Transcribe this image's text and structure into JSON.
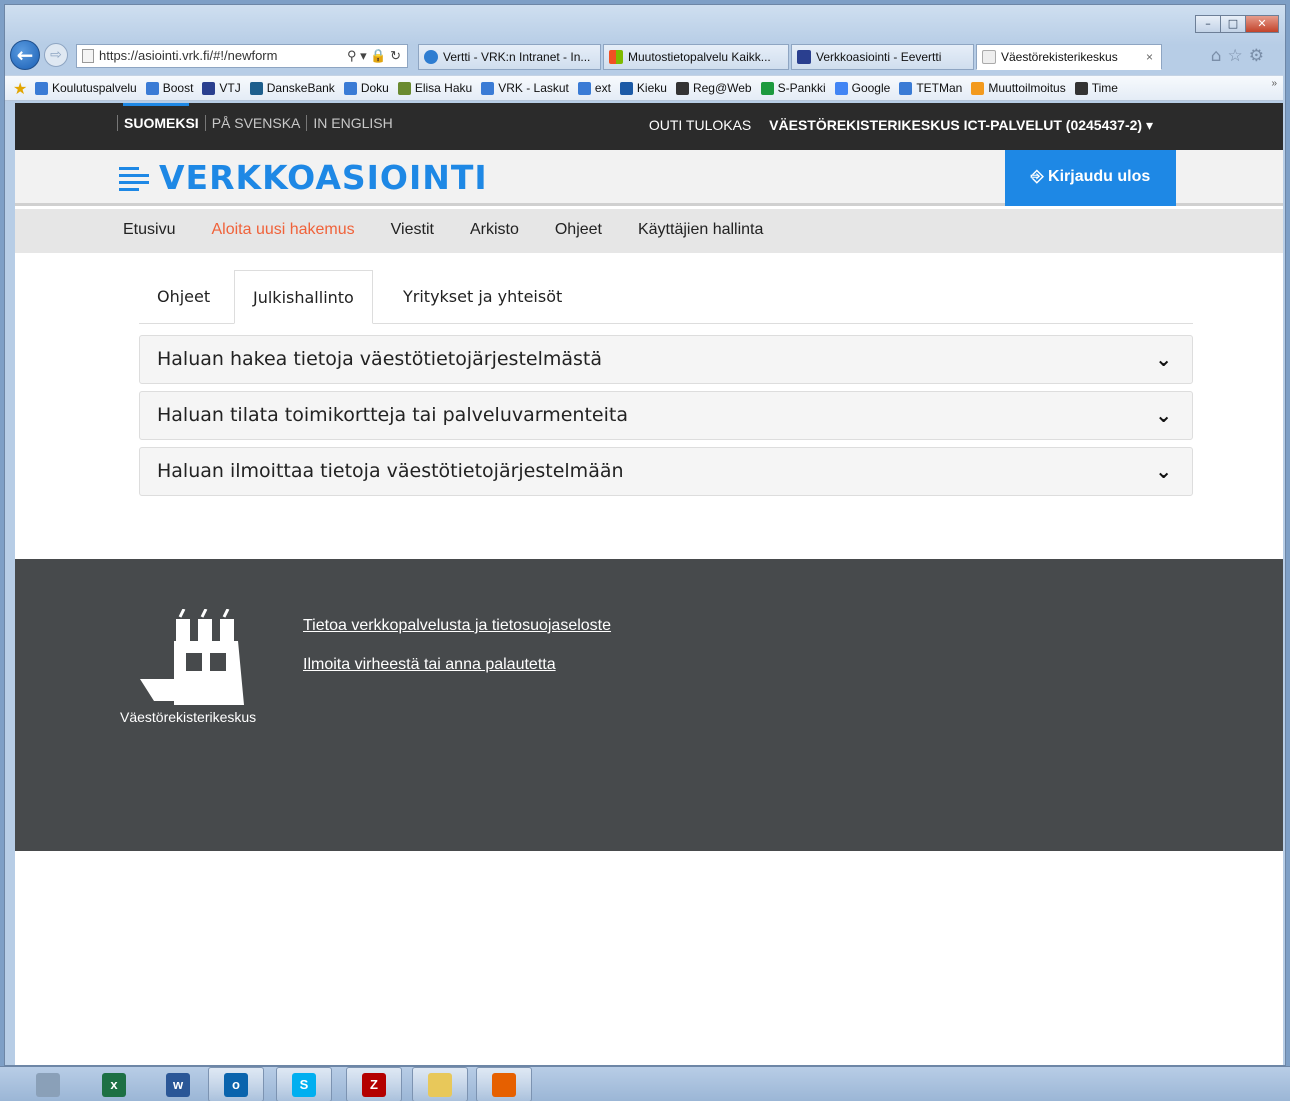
{
  "browser": {
    "address": "https://asiointi.vrk.fi/#!/newform",
    "address_actions": "⚲ ▾ 🔒 ↻",
    "tabs": [
      {
        "label": "Vertti - VRK:n Intranet - In...",
        "color": "#2e7dd1"
      },
      {
        "label": "Muutostietopalvelu Kaikk...",
        "color": "#e8a000"
      },
      {
        "label": "Verkkoasiointi - Eevertti",
        "color": "#2a3f8f"
      },
      {
        "label": "Väestörekisterikeskus",
        "color": "#d0d0d0"
      }
    ],
    "tab_close": "×",
    "back_icon": "←",
    "forward_icon": "⇨",
    "toolbar_icons": "⌂☆⚙",
    "window_controls": {
      "minimize": "–",
      "maximize": "□",
      "close": "✕"
    }
  },
  "favorites": {
    "more": "»",
    "items": [
      {
        "label": "Koulutuspalvelu",
        "icon": "ie-page-icon",
        "color": "#3a7bd5"
      },
      {
        "label": "Boost",
        "icon": "ie-page-icon",
        "color": "#3a7bd5"
      },
      {
        "label": "VTJ",
        "icon": "vtj-icon",
        "color": "#2a3f8f"
      },
      {
        "label": "DanskeBank",
        "icon": "danske-icon",
        "color": "#1d5e8c"
      },
      {
        "label": "Doku",
        "icon": "ie-page-icon",
        "color": "#3a7bd5"
      },
      {
        "label": "Elisa Haku",
        "icon": "elisa-icon",
        "color": "#6a8a30"
      },
      {
        "label": "VRK - Laskut",
        "icon": "ie-page-icon",
        "color": "#3a7bd5"
      },
      {
        "label": "ext",
        "icon": "ie-page-icon",
        "color": "#3a7bd5"
      },
      {
        "label": "Kieku",
        "icon": "sap-icon",
        "color": "#1c5aa6"
      },
      {
        "label": "Reg@Web",
        "icon": "regweb-icon",
        "color": "#333333"
      },
      {
        "label": "S-Pankki",
        "icon": "spankki-icon",
        "color": "#1d9a3e"
      },
      {
        "label": "Google",
        "icon": "google-icon",
        "color": "#4285f4"
      },
      {
        "label": "TETMan",
        "icon": "ie-page-icon",
        "color": "#3a7bd5"
      },
      {
        "label": "Muuttoilmoitus",
        "icon": "p-icon",
        "color": "#f39a1d"
      },
      {
        "label": "Time",
        "icon": "time-icon",
        "color": "#333333"
      }
    ]
  },
  "topbar": {
    "languages": [
      "SUOMEKSI",
      "PÅ SVENSKA",
      "IN ENGLISH"
    ],
    "user_name": "OUTI TULOKAS",
    "organization": "VÄESTÖREKISTERIKESKUS ICT-PALVELUT (0245437-2)",
    "org_caret": "▾"
  },
  "header": {
    "logo_text": "VERKKOASIOINTI",
    "logout_label": "Kirjaudu ulos",
    "logout_icon": "⎆"
  },
  "nav": {
    "items": [
      "Etusivu",
      "Aloita uusi hakemus",
      "Viestit",
      "Arkisto",
      "Ohjeet",
      "Käyttäjien hallinta"
    ],
    "active_index": 1
  },
  "content_tabs": {
    "items": [
      "Ohjeet",
      "Julkishallinto",
      "Yritykset ja yhteisöt"
    ],
    "active_index": 1
  },
  "accordion": {
    "items": [
      "Haluan hakea tietoja väestötietojärjestelmästä",
      "Haluan tilata toimikortteja tai palveluvarmenteita",
      "Haluan ilmoittaa tietoja väestötietojärjestelmään"
    ],
    "chevron": "❯"
  },
  "footer": {
    "org_name": "Väestörekisterikeskus",
    "links": [
      "Tietoa verkkopalvelusta ja tietosuojaseloste",
      "Ilmoita virheestä tai anna palautetta"
    ]
  },
  "taskbar": {
    "apps": [
      {
        "name": "calculator",
        "label": "",
        "color": "#8aa0b8"
      },
      {
        "name": "excel",
        "label": "x",
        "color": "#1d7044"
      },
      {
        "name": "word",
        "label": "w",
        "color": "#2b5797"
      },
      {
        "name": "outlook",
        "label": "o",
        "color": "#0a64ad"
      },
      {
        "name": "skype",
        "label": "S",
        "color": "#00aff0"
      },
      {
        "name": "filezilla",
        "label": "Z",
        "color": "#b40000"
      },
      {
        "name": "explorer",
        "label": "",
        "color": "#e8c85a"
      },
      {
        "name": "firefox",
        "label": "",
        "color": "#e66000"
      }
    ]
  },
  "colors": {
    "brand_blue": "#1e88e5",
    "active_nav": "#f0623a",
    "topbar": "#2b2b2b",
    "footer": "#474a4c"
  }
}
